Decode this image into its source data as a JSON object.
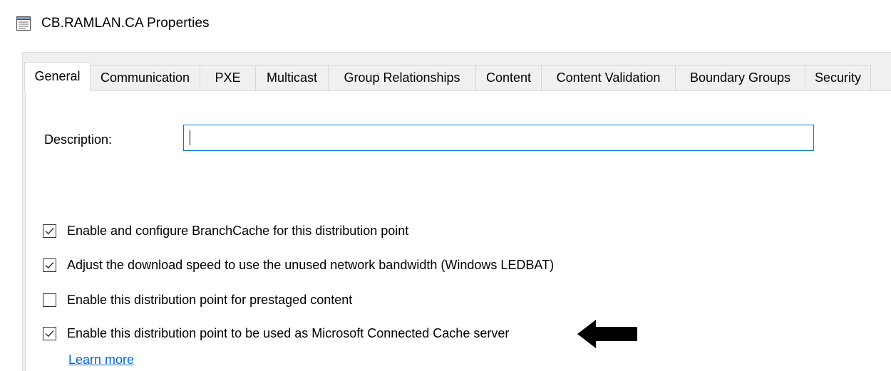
{
  "window": {
    "title": "CB.RAMLAN.CA Properties",
    "icon": "properties-sheet-icon"
  },
  "tabs": [
    {
      "label": "General",
      "active": true
    },
    {
      "label": "Communication",
      "active": false
    },
    {
      "label": "PXE",
      "active": false
    },
    {
      "label": "Multicast",
      "active": false
    },
    {
      "label": "Group Relationships",
      "active": false
    },
    {
      "label": "Content",
      "active": false
    },
    {
      "label": "Content Validation",
      "active": false
    },
    {
      "label": "Boundary Groups",
      "active": false
    },
    {
      "label": "Security",
      "active": false
    }
  ],
  "general": {
    "description_label": "Description:",
    "description_value": "",
    "checkboxes": [
      {
        "label": "Enable and configure BranchCache for this distribution point",
        "checked": true
      },
      {
        "label": "Adjust the download speed to use the unused network bandwidth (Windows LEDBAT)",
        "checked": true
      },
      {
        "label": "Enable this distribution point for prestaged content",
        "checked": false
      },
      {
        "label": "Enable this distribution point to be used as Microsoft Connected Cache server",
        "checked": true
      }
    ],
    "learn_more": "Learn more"
  },
  "annotation": {
    "icon": "left-arrow-icon",
    "color": "#000000"
  },
  "colors": {
    "focus_border": "#0078d7",
    "link": "#0066cc",
    "dialog_background": "#f0f0f0"
  }
}
